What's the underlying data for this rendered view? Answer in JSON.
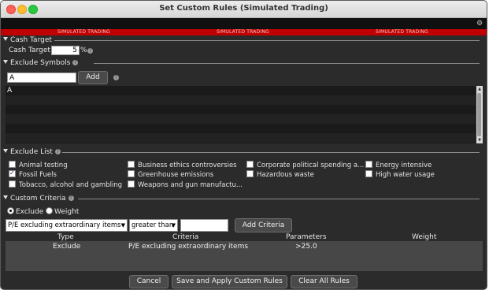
{
  "window": {
    "title": "Set Custom Rules (Simulated Trading)"
  },
  "banner": {
    "text": "SIMULATED TRADING"
  },
  "cash_target": {
    "header": "Cash Target",
    "label": "Cash Target",
    "value": "5",
    "unit": "%"
  },
  "exclude_symbols": {
    "header": "Exclude Symbols",
    "input_value": "A",
    "add_label": "Add",
    "symbols": [
      "A"
    ]
  },
  "exclude_list": {
    "header": "Exclude List",
    "items": [
      {
        "label": "Animal testing",
        "checked": false
      },
      {
        "label": "Business ethics controversies",
        "checked": false
      },
      {
        "label": "Corporate political spending a...",
        "checked": false
      },
      {
        "label": "Energy intensive",
        "checked": false
      },
      {
        "label": "Fossil Fuels",
        "checked": true
      },
      {
        "label": "Greenhouse emissions",
        "checked": false
      },
      {
        "label": "Hazardous waste",
        "checked": false
      },
      {
        "label": "High water usage",
        "checked": false
      },
      {
        "label": "Tobacco, alcohol and gambling",
        "checked": false
      },
      {
        "label": "Weapons and gun manufactu...",
        "checked": false
      }
    ]
  },
  "custom_criteria": {
    "header": "Custom Criteria",
    "radios": [
      {
        "label": "Exclude",
        "selected": true
      },
      {
        "label": "Weight",
        "selected": false
      }
    ],
    "criteria_select": "P/E excluding extraordinary items",
    "operator_select": "greater than",
    "value_input": "",
    "add_label": "Add Criteria",
    "columns": [
      "Type",
      "Criteria",
      "Parameters",
      "Weight"
    ],
    "rows": [
      {
        "type": "Exclude",
        "criteria": "P/E excluding extraordinary items",
        "parameters": ">25.0",
        "weight": ""
      }
    ]
  },
  "footer": {
    "cancel": "Cancel",
    "save_apply": "Save and Apply Custom Rules",
    "clear_all": "Clear All Rules"
  },
  "colors": {
    "background": "#2b2b2b",
    "banner_red": "#c00000",
    "selected_row": "#474747"
  },
  "icons": [
    "gear-icon",
    "help-icon",
    "collapse-triangle-icon",
    "checkbox-check-icon",
    "dropdown-caret-icon"
  ]
}
